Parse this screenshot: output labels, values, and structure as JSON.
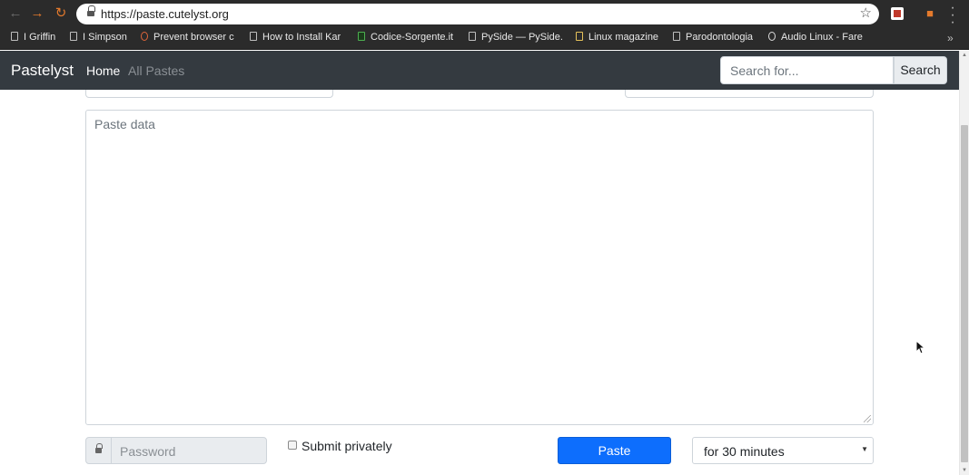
{
  "browser": {
    "url": "https://paste.cutelyst.org",
    "bookmarks": [
      {
        "label": "I Griffin"
      },
      {
        "label": "I Simpson"
      },
      {
        "label": "Prevent browser c"
      },
      {
        "label": "How to Install Kar"
      },
      {
        "label": "Codice-Sorgente.it"
      },
      {
        "label": "PySide — PySide.Q"
      },
      {
        "label": "Linux magazine"
      },
      {
        "label": "Parodontologia"
      },
      {
        "label": "Audio Linux - Fare"
      }
    ],
    "overflow_label": "»"
  },
  "navbar": {
    "brand": "Pastelyst",
    "home": "Home",
    "all_pastes": "All Pastes",
    "search_placeholder": "Search for...",
    "search_button": "Search"
  },
  "form": {
    "paste_placeholder": "Paste data",
    "password_placeholder": "Password",
    "submit_private_label": "Submit privately",
    "submit_private_checked": false,
    "paste_button": "Paste",
    "expiration_selected": "for 30 minutes"
  },
  "colors": {
    "navbar_bg": "#343a40",
    "primary": "#0d6efd",
    "chrome_bg": "#2b2b2b"
  },
  "icons": {
    "back": "arrow-left-icon",
    "forward": "arrow-right-icon",
    "reload": "reload-icon",
    "lock": "lock-icon",
    "bookmark_star": "star-icon",
    "menu": "kebab-menu-icon"
  }
}
